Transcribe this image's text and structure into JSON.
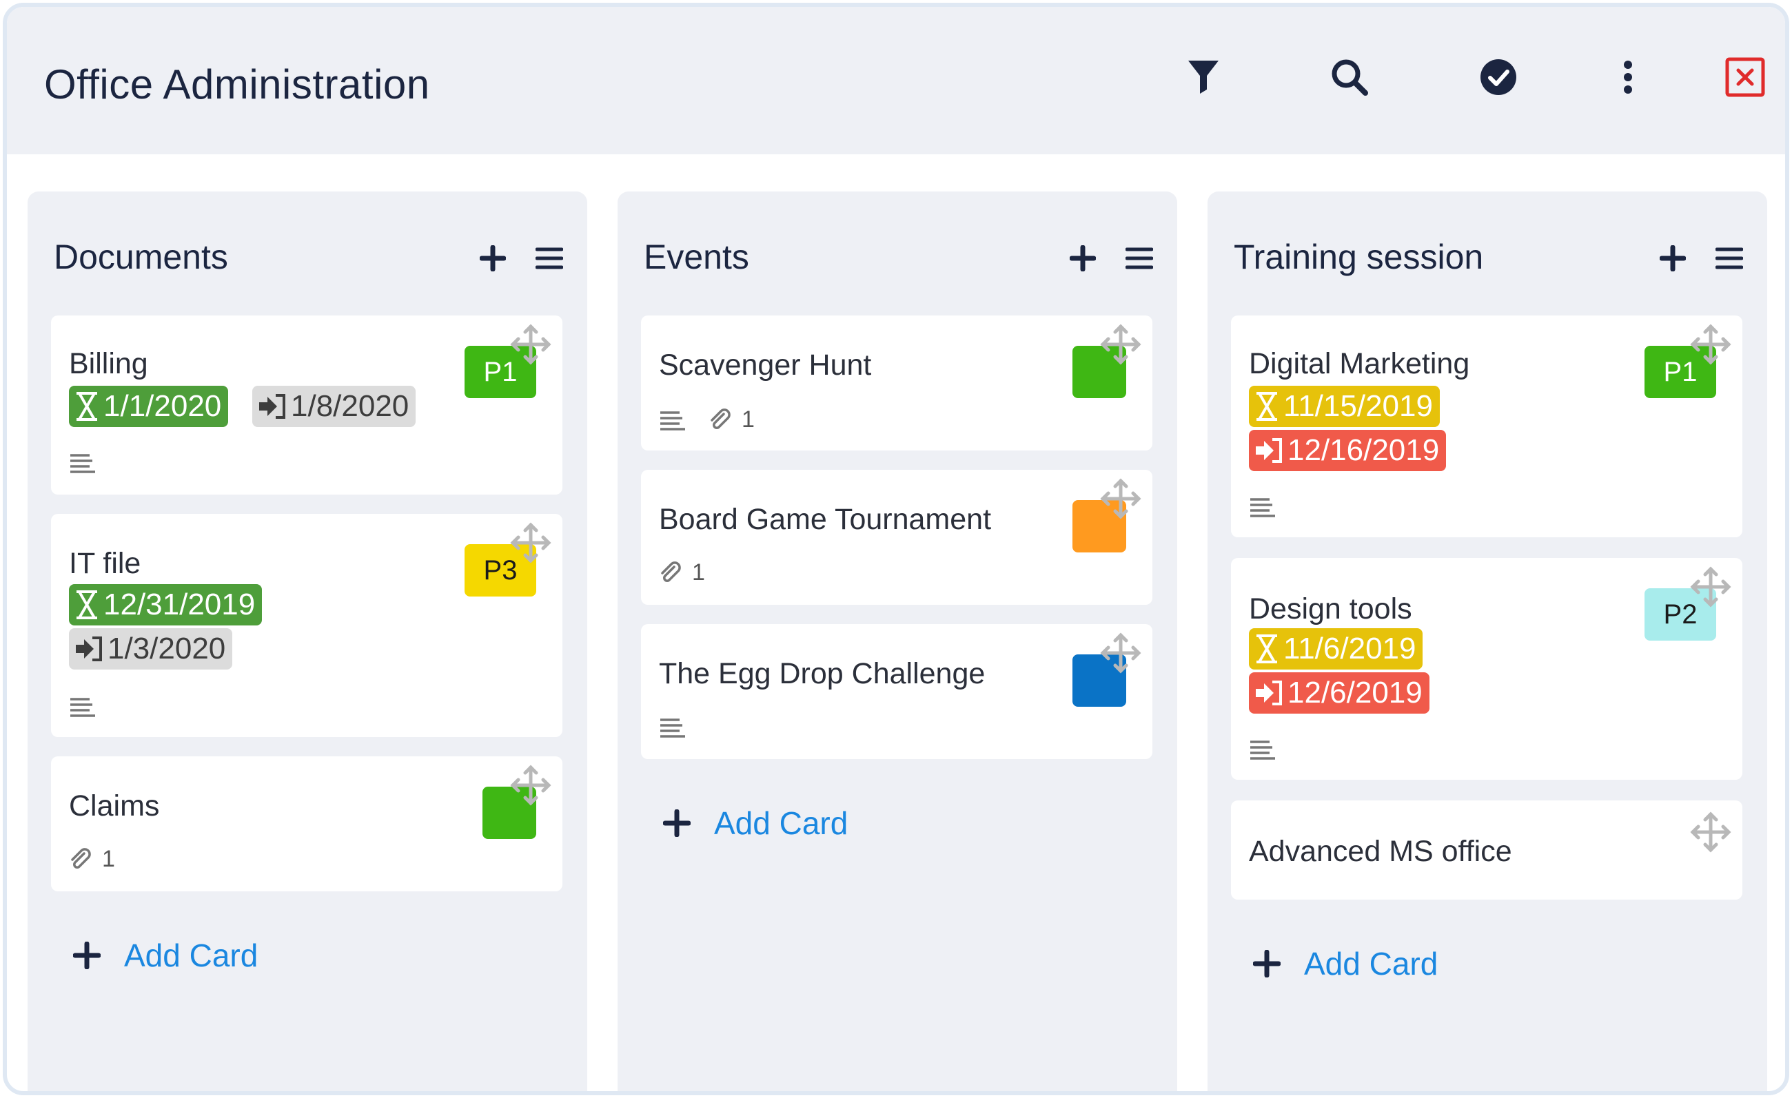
{
  "app": {
    "title": "Office Administration"
  },
  "toolbar": {
    "icons": [
      "filter-icon",
      "search-icon",
      "check-circle-icon",
      "more-vertical-icon",
      "close-icon"
    ],
    "close_color": "#e02b2b"
  },
  "columns": [
    {
      "title": "Documents",
      "add_card_label": "Add Card",
      "cards": [
        {
          "title": "Billing",
          "priority": "P1",
          "priority_color": "#3fb714",
          "start_date": "1/1/2020",
          "due_date": "1/8/2020",
          "has_description": true
        },
        {
          "title": "IT file",
          "priority": "P3",
          "priority_color": "#f5d800",
          "start_date": "12/31/2019",
          "due_date": "1/3/2020",
          "has_description": true
        },
        {
          "title": "Claims",
          "color": "#3fb714",
          "attachments": "1"
        }
      ]
    },
    {
      "title": "Events",
      "add_card_label": "Add Card",
      "cards": [
        {
          "title": "Scavenger Hunt",
          "color": "#3fb714",
          "has_description": true,
          "attachments": "1"
        },
        {
          "title": "Board Game Tournament",
          "color": "#ff9a1f",
          "attachments": "1"
        },
        {
          "title": "The Egg Drop Challenge",
          "color": "#0a73c6",
          "has_description": true
        }
      ]
    },
    {
      "title": "Training session",
      "add_card_label": "Add Card",
      "cards": [
        {
          "title": "Digital Marketing",
          "priority": "P1",
          "priority_color": "#3fb714",
          "start_date": "11/15/2019",
          "due_date": "12/16/2019",
          "has_description": true
        },
        {
          "title": "Design tools",
          "priority": "P2",
          "priority_color": "#a8ecec",
          "start_date": "11/6/2019",
          "due_date": "12/6/2019",
          "has_description": true
        },
        {
          "title": "Advanced MS office"
        }
      ]
    }
  ]
}
